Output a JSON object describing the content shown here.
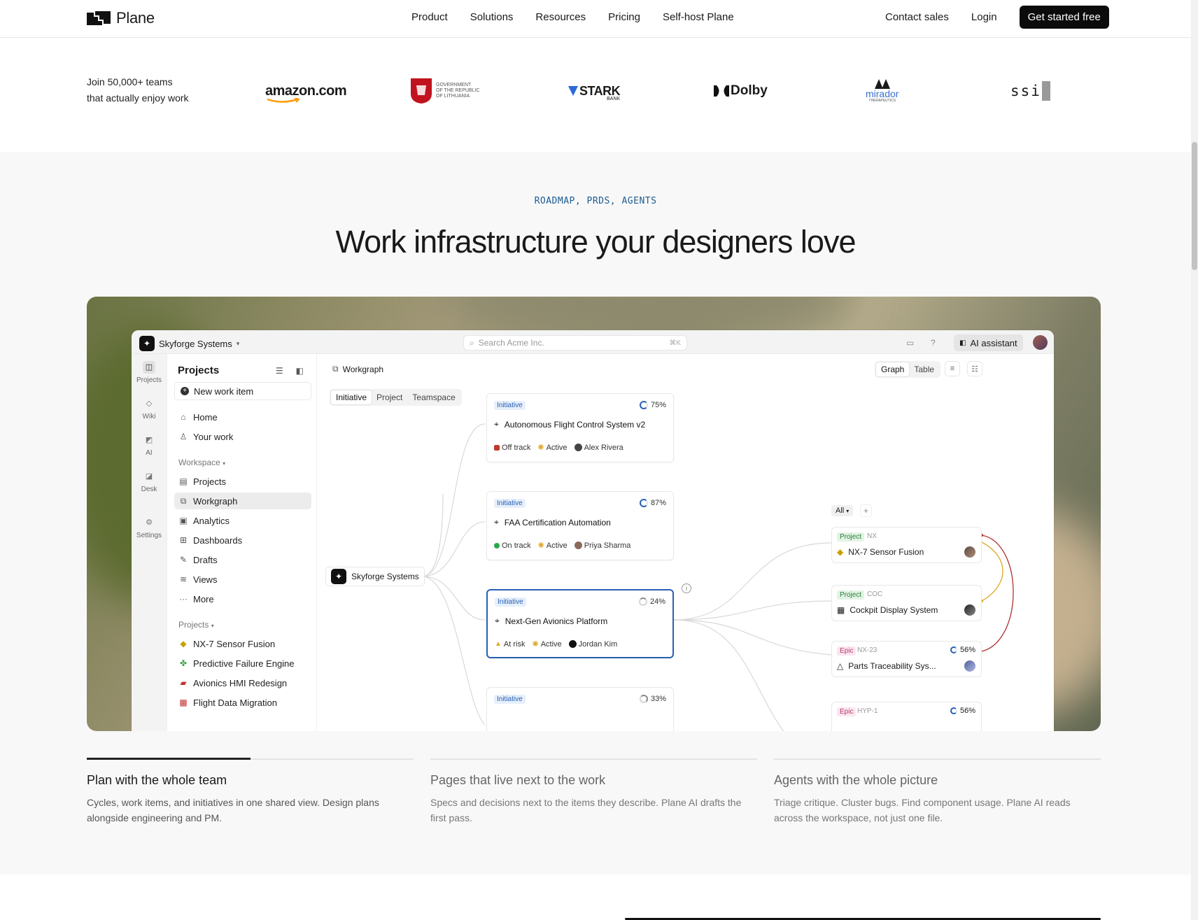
{
  "nav": {
    "brand": "Plane",
    "links": [
      "Product",
      "Solutions",
      "Resources",
      "Pricing",
      "Self-host Plane"
    ],
    "contact": "Contact sales",
    "login": "Login",
    "cta": "Get started free"
  },
  "logos": {
    "intro_line1": "Join 50,000+ teams",
    "intro_line2": "that actually enjoy work",
    "amazon": "amazon.com",
    "lithuania_line1": "GOVERNMENT",
    "lithuania_line2": "OF THE REPUBLIC",
    "lithuania_line3": "OF LITHUANIA",
    "stark": "STARK",
    "stark_sub": "BANK",
    "dolby": "Dolby",
    "mirador": "mirador",
    "mirador_sub": "THERAPEUTICS",
    "ssi": "ssi"
  },
  "section": {
    "eyebrow": "ROADMAP, PRDS, AGENTS",
    "headline": "Work infrastructure your designers love"
  },
  "app": {
    "workspace": "Skyforge Systems",
    "search_placeholder": "Search Acme Inc.",
    "search_kbd": "⌘K",
    "ai_assistant": "AI assistant",
    "rail": [
      "Projects",
      "Wiki",
      "AI",
      "Desk",
      "Settings"
    ],
    "sidebar": {
      "title": "Projects",
      "new_item": "New work item",
      "home": "Home",
      "your_work": "Your work",
      "workspace_head": "Workspace",
      "workspace_items": [
        "Projects",
        "Workgraph",
        "Analytics",
        "Dashboards",
        "Drafts",
        "Views",
        "More"
      ],
      "projects_head": "Projects",
      "projects": [
        "NX-7 Sensor Fusion",
        "Predictive Failure Engine",
        "Avionics HMI Redesign",
        "Flight Data Migration"
      ]
    },
    "main": {
      "title": "Workgraph",
      "view_graph": "Graph",
      "view_table": "Table",
      "filters": [
        "Initiative",
        "Project",
        "Teamspace"
      ],
      "root": "Skyforge Systems",
      "cards": [
        {
          "tag": "Initiative",
          "pct": "75%",
          "title": "Autonomous Flight Control System v2",
          "status": "Off track",
          "state": "Active",
          "owner": "Alex Rivera"
        },
        {
          "tag": "Initiative",
          "pct": "87%",
          "title": "FAA Certification Automation",
          "status": "On track",
          "state": "Active",
          "owner": "Priya Sharma"
        },
        {
          "tag": "Initiative",
          "pct": "24%",
          "title": "Next-Gen Avionics Platform",
          "status": "At risk",
          "state": "Active",
          "owner": "Jordan Kim"
        },
        {
          "tag": "Initiative",
          "pct": "33%"
        }
      ],
      "all_filter": "All",
      "right_cards": [
        {
          "tag": "Project",
          "code": "NX",
          "title": "NX-7 Sensor Fusion"
        },
        {
          "tag": "Project",
          "code": "COC",
          "title": "Cockpit Display System"
        },
        {
          "tag": "Epic",
          "code": "NX-23",
          "pct": "56%",
          "title": "Parts Traceability Sys..."
        },
        {
          "tag": "Epic",
          "code": "HYP-1",
          "pct": "56%"
        }
      ]
    }
  },
  "features": [
    {
      "title": "Plan with the whole team",
      "desc": "Cycles, work items, and initiatives in one shared view. Design plans alongside engineering and PM.",
      "progress": 0.5
    },
    {
      "title": "Pages that live next to the work",
      "desc": "Specs and decisions next to the items they describe. Plane AI drafts the first pass."
    },
    {
      "title": "Agents with the whole picture",
      "desc": "Triage critique. Cluster bugs. Find component usage. Plane AI reads across the workspace, not just one file."
    }
  ]
}
